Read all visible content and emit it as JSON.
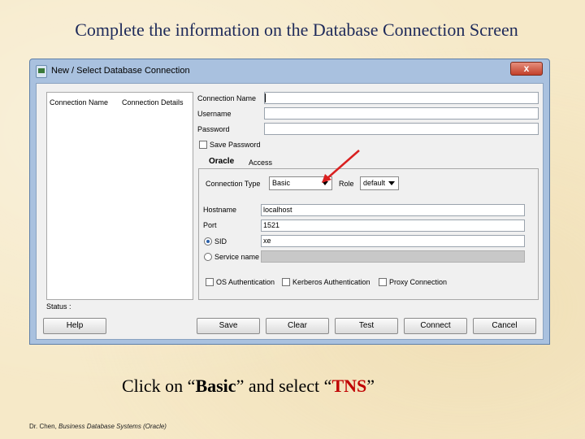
{
  "slide": {
    "title": "Complete the information on the Database Connection Screen",
    "caption_prefix": "Click on “",
    "caption_basic": "Basic",
    "caption_middle": "” and select “",
    "caption_tns": "TNS",
    "caption_suffix": "”",
    "footer_author": "Dr. Chen, ",
    "footer_title": "Business Database Systems (Oracle)"
  },
  "dialog": {
    "title": "New / Select Database Connection",
    "close_label": "x",
    "list": {
      "columns": [
        "Connection Name",
        "Connection Details"
      ]
    },
    "form": {
      "connection_name_label": "Connection Name",
      "connection_name_value": "",
      "username_label": "Username",
      "username_value": "",
      "password_label": "Password",
      "password_value": "",
      "save_password_label": "Save Password",
      "tabs": [
        "Oracle",
        "Access"
      ],
      "connection_type_label": "Connection Type",
      "connection_type_value": "Basic",
      "role_label": "Role",
      "role_value": "default",
      "hostname_label": "Hostname",
      "hostname_value": "localhost",
      "port_label": "Port",
      "port_value": "1521",
      "sid_label": "SID",
      "sid_value": "xe",
      "service_name_label": "Service name",
      "service_name_value": "",
      "os_auth_label": "OS Authentication",
      "kerberos_label": "Kerberos Authentication",
      "proxy_label": "Proxy Connection"
    },
    "status_label": "Status :",
    "buttons": {
      "help": "Help",
      "save": "Save",
      "clear": "Clear",
      "test": "Test",
      "connect": "Connect",
      "cancel": "Cancel"
    }
  },
  "annotation": {
    "arrow_color": "#d92020"
  }
}
